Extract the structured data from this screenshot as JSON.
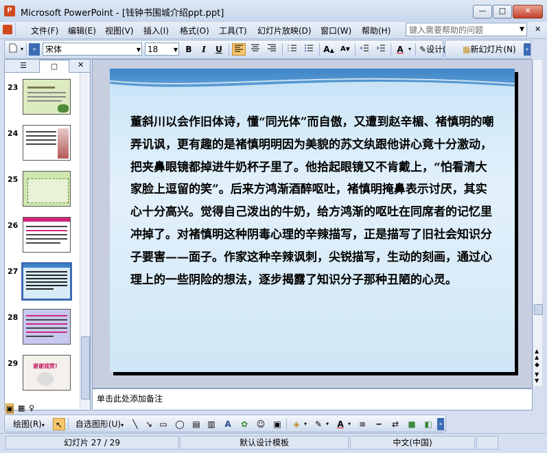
{
  "window": {
    "title": "Microsoft PowerPoint - [钱钟书围城介绍ppt.ppt]",
    "app_icon_letter": "P",
    "min_label": "—",
    "max_label": "□",
    "close_label": "✕"
  },
  "menu": {
    "items": [
      "文件(F)",
      "编辑(E)",
      "视图(V)",
      "插入(I)",
      "格式(O)",
      "工具(T)",
      "幻灯片放映(D)",
      "窗口(W)",
      "帮助(H)"
    ],
    "help_placeholder": "键入需要帮助的问题",
    "close_label": "✕"
  },
  "toolbar": {
    "font_name": "宋体",
    "font_size": "18",
    "bold": "B",
    "italic": "I",
    "underline": "U",
    "design_label": "设计(S)",
    "new_slide_label": "新幻灯片(N)"
  },
  "thumbnails": [
    {
      "number": "23",
      "bg": "#dcebc0"
    },
    {
      "number": "24",
      "bg": "#ffffff"
    },
    {
      "number": "25",
      "bg": "#cfe6b0"
    },
    {
      "number": "26",
      "bg": "#ffffff"
    },
    {
      "number": "27",
      "bg": "#d8ebf8"
    },
    {
      "number": "28",
      "bg": "#c7c8ef"
    },
    {
      "number": "29",
      "bg": "#f4f0ec"
    }
  ],
  "thumbnail_29_text": "谢谢观赏!",
  "slide": {
    "text": "董斜川以会作旧体诗，懂“同光体”而自傲，又遭到赵辛楣、褚慎明的嘲弄讥讽，更有趣的是褚慎明明因为美貌的苏文纨跟他讲心竟十分激动，把夹鼻眼镜都掉进牛奶杯子里了。他拾起眼镜又不肯戴上，“怕看清大家脸上逗留的笑”。后来方鸿渐酒醉呕吐，褚慎明掩鼻表示讨厌，其实心十分高兴。觉得自己泼出的牛奶，给方鸿渐的呕吐在同席者的记忆里冲掉了。对褚慎明这种阴毒心理的辛辣描写，正是描写了旧社会知识分子要害——面子。作家这种辛辣讽刺，尖锐描写，生动的刻画，通过心理上的一些阴险的想法，逐步揭露了知识分子那种丑陋的心灵。"
  },
  "notes": {
    "placeholder": "单击此处添加备注"
  },
  "draw_toolbar": {
    "draw_label": "绘图(R)",
    "autoshapes_label": "自选图形(U)"
  },
  "status": {
    "slide_info": "幻灯片 27 / 29",
    "template": "默认设计模板",
    "language": "中文(中国)"
  }
}
